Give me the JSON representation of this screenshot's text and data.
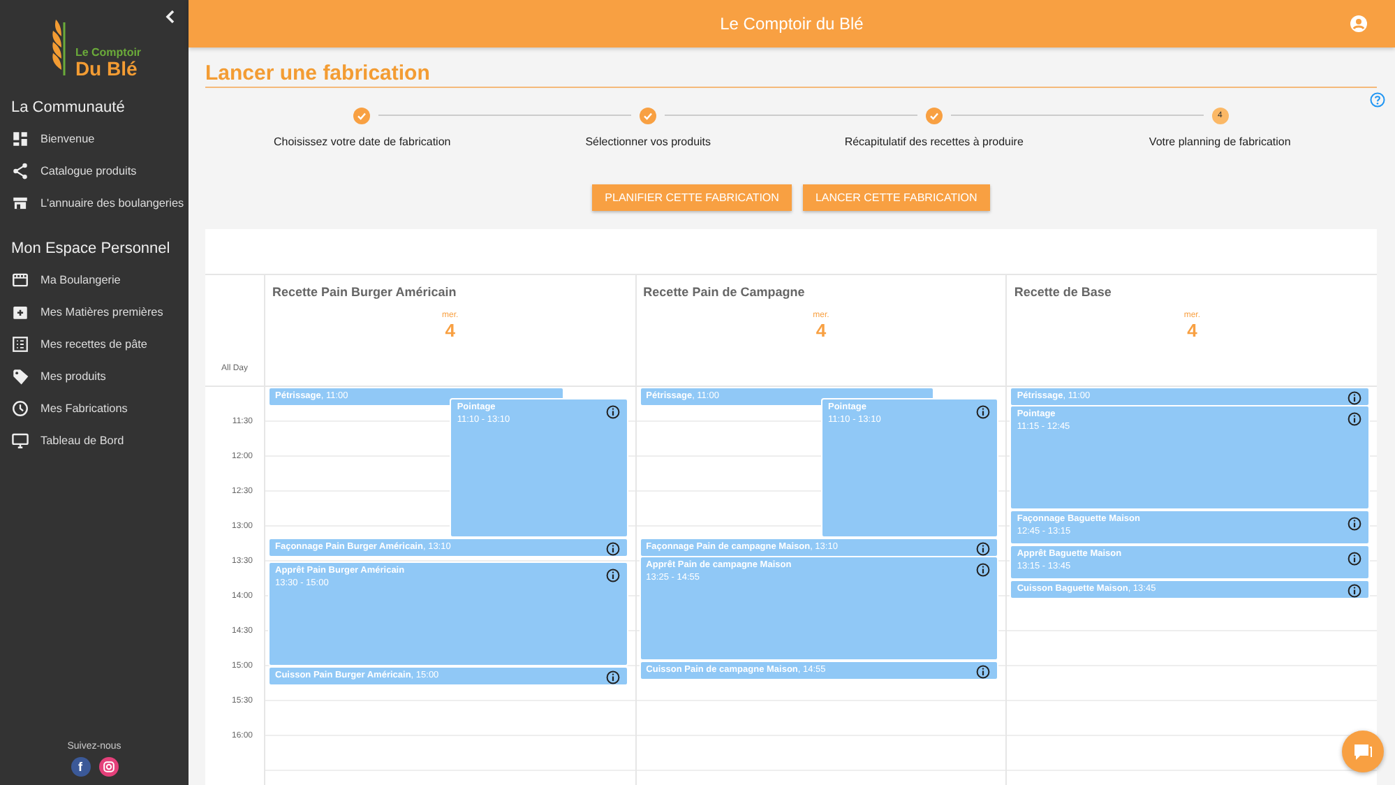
{
  "logo": {
    "line1": "Le Comptoir",
    "line2": "Du Blé"
  },
  "sidebar": {
    "sections": [
      {
        "title": "La Communauté",
        "items": [
          {
            "label": "Bienvenue"
          },
          {
            "label": "Catalogue produits"
          },
          {
            "label": "L'annuaire des boulangeries"
          }
        ]
      },
      {
        "title": "Mon Espace Personnel",
        "items": [
          {
            "label": "Ma Boulangerie"
          },
          {
            "label": "Mes Matières premières"
          },
          {
            "label": "Mes recettes de pâte"
          },
          {
            "label": "Mes produits"
          },
          {
            "label": "Mes Fabrications"
          },
          {
            "label": "Tableau de Bord"
          }
        ]
      }
    ],
    "follow": "Suivez-nous",
    "social": [
      {
        "kind": "facebook",
        "label": "f",
        "color": "#3b5998"
      },
      {
        "kind": "instagram",
        "color": "#e4407a"
      }
    ]
  },
  "header": {
    "title": "Le Comptoir du Blé"
  },
  "page_title": "Lancer une fabrication",
  "steps": [
    {
      "label": "Choisissez votre date de fabrication",
      "done": true
    },
    {
      "label": "Sélectionner vos produits",
      "done": true
    },
    {
      "label": "Récapitulatif des recettes à produire",
      "done": true
    },
    {
      "label": "Votre planning de fabrication",
      "done": false,
      "number": "4"
    }
  ],
  "buttons": [
    "PLANIFIER CETTE FABRICATION",
    "LANCER CETTE FABRICATION"
  ],
  "calendar": {
    "all_day": "All Day",
    "times": [
      "11:30",
      "12:00",
      "12:30",
      "13:00",
      "13:30",
      "14:00",
      "14:30",
      "15:00",
      "15:30",
      "16:00"
    ],
    "columns": [
      {
        "title": "Recette Pain Burger Américain",
        "weekday": "mer.",
        "day": "4",
        "events": [
          {
            "kind": "inline",
            "label": "**Pétrissage**, 11:00",
            "indented": false
          },
          {
            "kind": "block",
            "title": "Pointage",
            "time": "11:10 - 13:10",
            "indented": true
          },
          {
            "kind": "inline",
            "label": "**Façonnage Pain Burger Américain**, 13:10",
            "indented": false
          },
          {
            "kind": "block",
            "title": "Apprêt Pain Burger Américain",
            "time": "13:30 - 15:00",
            "indented": false
          },
          {
            "kind": "inline",
            "label": "**Cuisson Pain Burger Américain**, 15:00",
            "indented": false
          }
        ]
      },
      {
        "title": "Recette Pain de Campagne",
        "weekday": "mer.",
        "day": "4",
        "events": [
          {
            "kind": "inline",
            "label": "**Pétrissage**, 11:00",
            "indented": false
          },
          {
            "kind": "block",
            "title": "Pointage",
            "time": "11:10 - 13:10",
            "indented": true
          },
          {
            "kind": "inline",
            "label": "**Façonnage Pain de campagne Maison**, 13:10",
            "indented": false
          },
          {
            "kind": "block",
            "title": "Apprêt Pain de campagne Maison",
            "time": "13:25 - 14:55",
            "indented": false
          },
          {
            "kind": "inline",
            "label": "**Cuisson Pain de campagne Maison**, 14:55",
            "indented": false
          }
        ]
      },
      {
        "title": "Recette de Base",
        "weekday": "mer.",
        "day": "4",
        "events": [
          {
            "kind": "inline",
            "label": "**Pétrissage**, 11:00",
            "indented": false
          },
          {
            "kind": "block",
            "title": "Pointage",
            "time": "11:15 - 12:45",
            "indented": false
          },
          {
            "kind": "block",
            "title": "Façonnage Baguette Maison",
            "time": "12:45 - 13:15",
            "indented": false
          },
          {
            "kind": "block",
            "title": "Apprêt Baguette Maison",
            "time": "13:15 - 13:45",
            "indented": false
          },
          {
            "kind": "inline",
            "label": "**Cuisson Baguette Maison**, 13:45",
            "indented": false
          }
        ]
      }
    ]
  }
}
